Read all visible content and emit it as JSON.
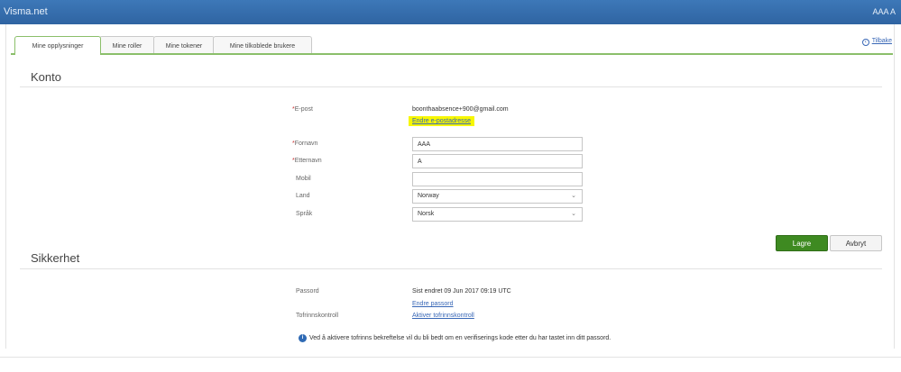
{
  "app": {
    "title": "Visma.net",
    "user": "AAA A"
  },
  "tabs": [
    {
      "label": "Mine opplysninger",
      "active": true
    },
    {
      "label": "Mine roller",
      "active": false
    },
    {
      "label": "Mine tokener",
      "active": false
    },
    {
      "label": "Mine tilkoblede brukere",
      "active": false
    }
  ],
  "back_link": "Tilbake",
  "account": {
    "heading": "Konto",
    "email_label": "E-post",
    "email_value": "boonthaabsence+900@gmail.com",
    "change_email_link": "Endre e-postadresse",
    "firstname_label": "Fornavn",
    "firstname_value": "AAA",
    "lastname_label": "Etternavn",
    "lastname_value": "A",
    "mobile_label": "Mobil",
    "mobile_value": "",
    "country_label": "Land",
    "country_value": "Norway",
    "language_label": "Språk",
    "language_value": "Norsk"
  },
  "actions": {
    "save": "Lagre",
    "cancel": "Avbryt"
  },
  "security": {
    "heading": "Sikkerhet",
    "password_label": "Passord",
    "password_value": "Sist endret 09 Jun 2017 09:19 UTC",
    "change_password_link": "Endre passord",
    "twofactor_label": "Tofrinnskontroll",
    "twofactor_link": "Aktiver tofrinnskontroll",
    "info_text": "Ved å aktivere tofrinns bekreftelse vil du bli bedt om en verifiserings kode etter du har tastet inn ditt passord."
  },
  "colors": {
    "topbar": "#3570b0",
    "accent_green": "#3e8a21",
    "link_blue": "#3867b6",
    "highlight": "#f7f700"
  }
}
